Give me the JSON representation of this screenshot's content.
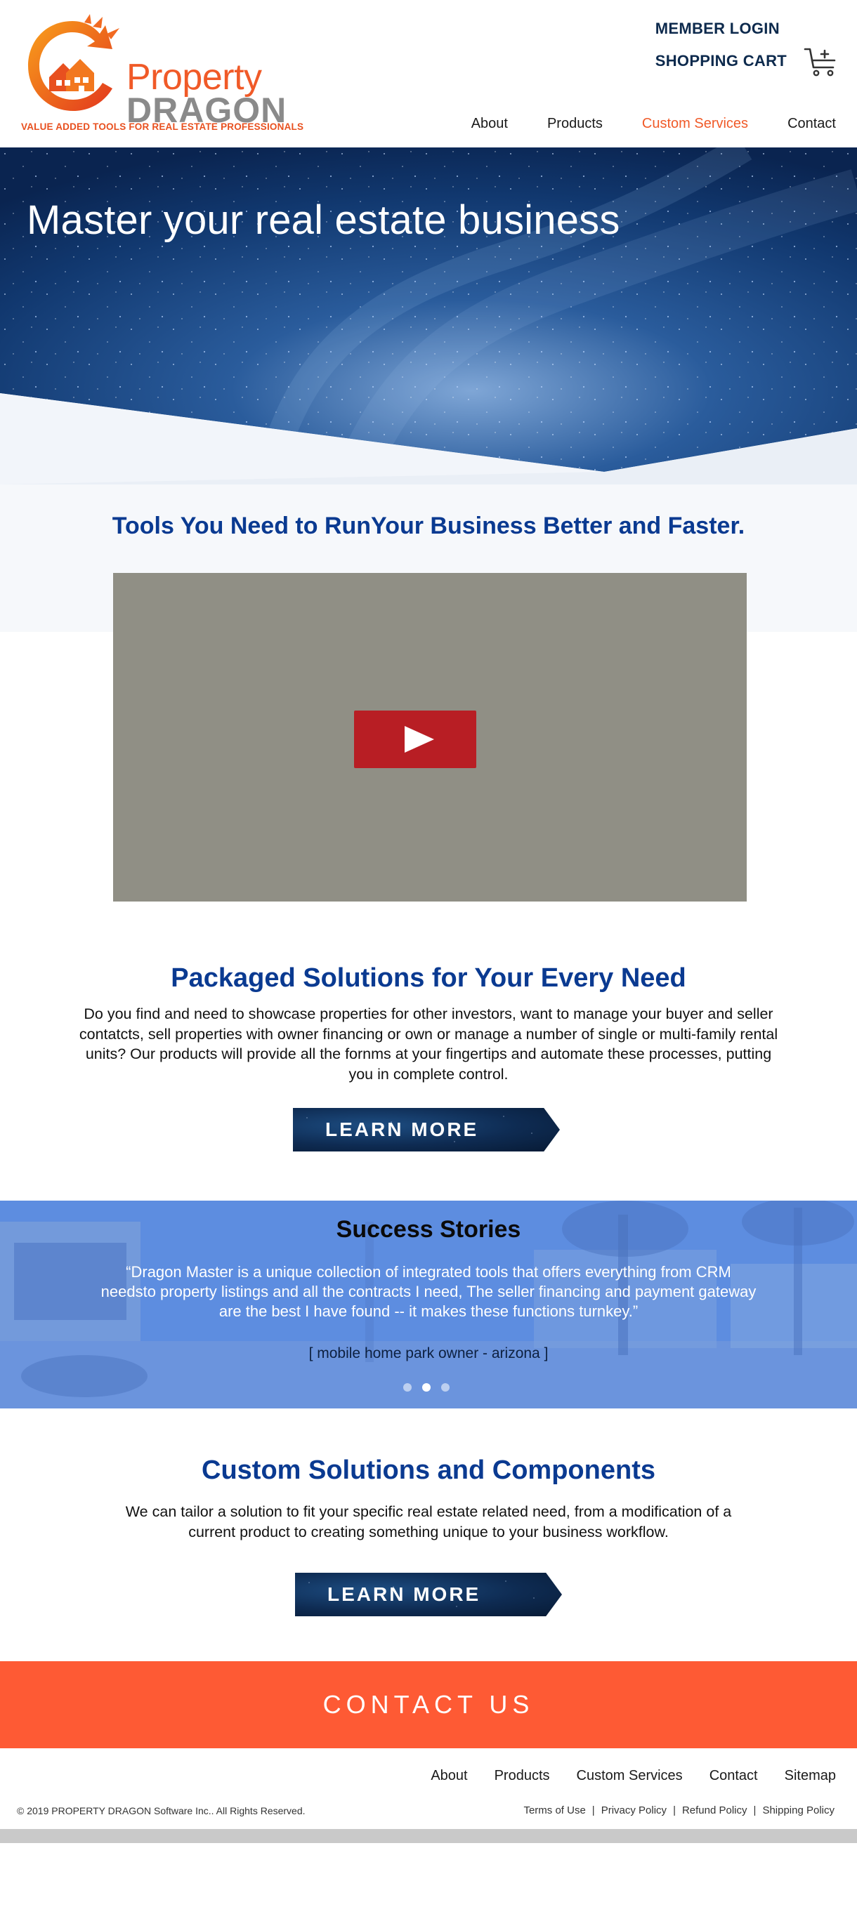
{
  "brand": {
    "name_line1": "Property",
    "name_line2": "DRAGON",
    "tagline": "VALUE ADDED TOOLS FOR REAL ESTATE PROFESSIONALS",
    "colors": {
      "orange": "#f05a28",
      "gray": "#8a8a8a",
      "navy": "#0d2a4d",
      "blue": "#0a3a91"
    }
  },
  "header": {
    "member_login": "MEMBER LOGIN",
    "shopping_cart": "SHOPPING CART",
    "cart_icon": "cart-add-icon",
    "nav": [
      {
        "label": "About",
        "active": false
      },
      {
        "label": "Products",
        "active": false
      },
      {
        "label": "Custom Services",
        "active": true
      },
      {
        "label": "Contact",
        "active": false
      }
    ]
  },
  "hero": {
    "title": "Master your real estate business"
  },
  "tools": {
    "title": "Tools You Need to RunYour Business Better and Faster."
  },
  "video": {
    "play_icon": "play-icon"
  },
  "packaged": {
    "title": "Packaged Solutions for Your Every Need",
    "text": "Do you find and need to showcase properties for other investors, want to manage your buyer and seller contatcts, sell properties with owner financing or own or manage a number of single or multi-family rental units? Our products will provide all the fornms at your fingertips and automate these processes, putting you in complete control.",
    "button": "LEARN MORE"
  },
  "success": {
    "title": "Success Stories",
    "quote": "“Dragon Master is a unique collection of integrated tools that offers everything from CRM needsto property listings and all the contracts I need, The seller financing and payment gateway are the best I have found -- it makes these functions turnkey.”",
    "author": "[ mobile home park owner - arizona ]",
    "slides": 3,
    "active_slide": 2
  },
  "custom": {
    "title": "Custom Solutions and Components",
    "text": "We can tailor a solution to fit your specific real estate related need, from a modification of a current product to creating something unique to your business workflow.",
    "button": "LEARN MORE"
  },
  "contact": {
    "label": "CONTACT US",
    "color": "#fe5a34"
  },
  "footer": {
    "nav": [
      "About",
      "Products",
      "Custom Services",
      "Contact",
      "Sitemap"
    ],
    "copyright": "© 2019 PROPERTY DRAGON Software Inc.. All Rights Reserved.",
    "legal": [
      "Terms of Use",
      "Privacy Policy",
      "Refund Policy",
      "Shipping Policy"
    ]
  }
}
